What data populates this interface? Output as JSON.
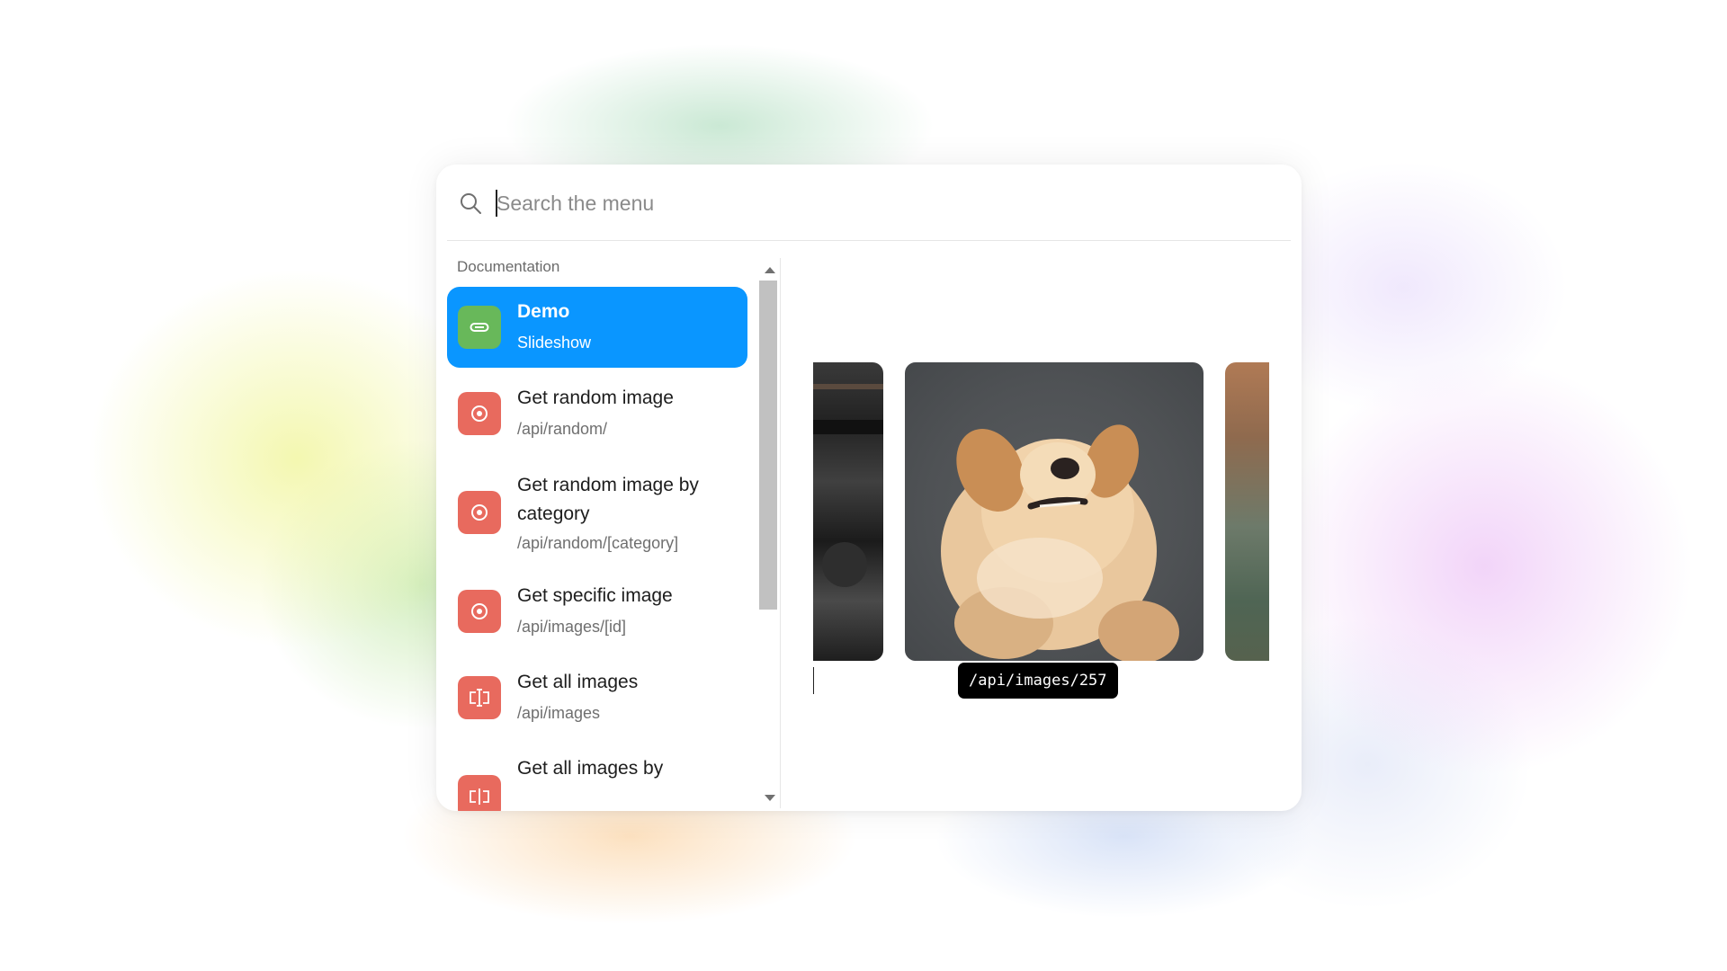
{
  "search": {
    "placeholder": "Search the menu"
  },
  "menu": {
    "section_label": "Documentation",
    "items": [
      {
        "title": "Demo",
        "subtitle": "Slideshow",
        "icon": "link-icon",
        "color": "#68b85a",
        "active": true
      },
      {
        "title": "Get random image",
        "subtitle": "/api/random/",
        "icon": "target-icon",
        "color": "#e86a5e"
      },
      {
        "title": "Get random image by category",
        "subtitle": "/api/random/[category]",
        "icon": "target-icon",
        "color": "#e86a5e"
      },
      {
        "title": "Get specific image",
        "subtitle": "/api/images/[id]",
        "icon": "target-icon",
        "color": "#e86a5e"
      },
      {
        "title": "Get all images",
        "subtitle": "/api/images",
        "icon": "text-cursor-icon",
        "color": "#e86a5e"
      },
      {
        "title": "Get all images by",
        "subtitle": "",
        "icon": "text-cursor-icon",
        "color": "#e86a5e"
      }
    ]
  },
  "preview": {
    "tooltip": "/api/images/257",
    "main_image": "dog-photo-image"
  },
  "colors": {
    "accent": "#0a96ff",
    "green_icon": "#68b85a",
    "red_icon": "#e86a5e"
  }
}
